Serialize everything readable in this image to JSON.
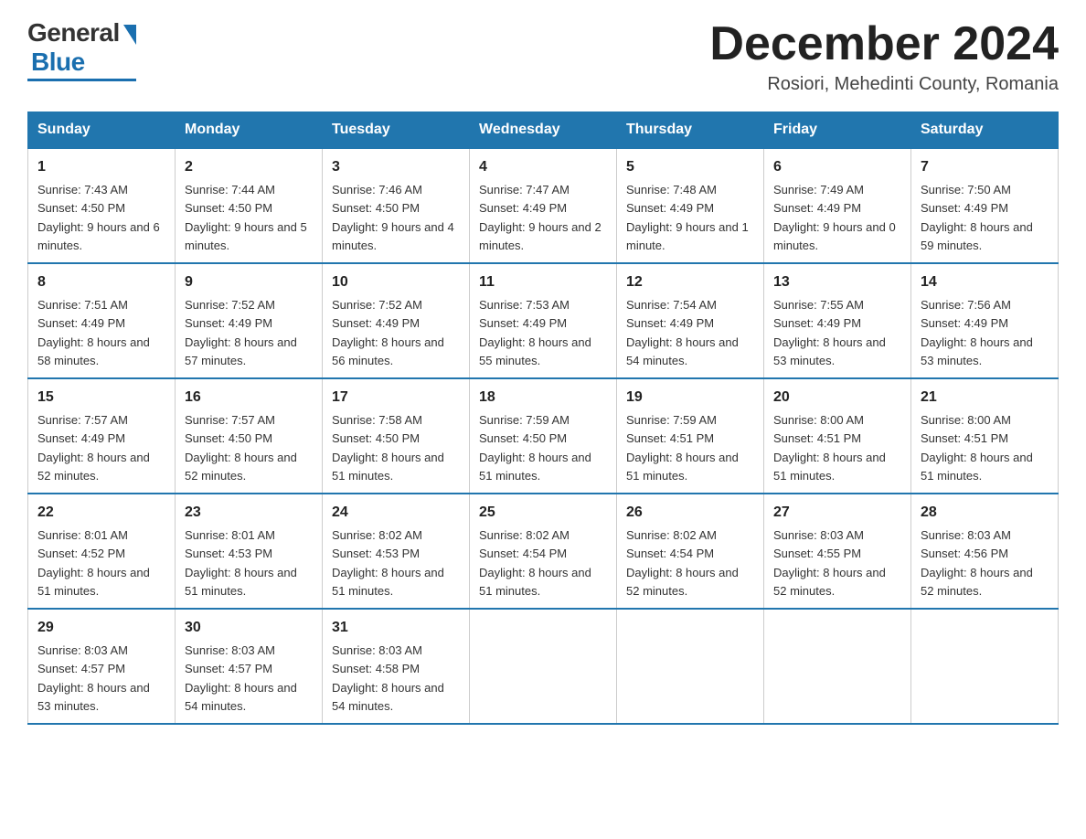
{
  "header": {
    "logo_general": "General",
    "logo_blue": "Blue",
    "month_title": "December 2024",
    "subtitle": "Rosiori, Mehedinti County, Romania"
  },
  "days_of_week": [
    "Sunday",
    "Monday",
    "Tuesday",
    "Wednesday",
    "Thursday",
    "Friday",
    "Saturday"
  ],
  "weeks": [
    [
      {
        "day": "1",
        "sunrise": "7:43 AM",
        "sunset": "4:50 PM",
        "daylight": "9 hours and 6 minutes."
      },
      {
        "day": "2",
        "sunrise": "7:44 AM",
        "sunset": "4:50 PM",
        "daylight": "9 hours and 5 minutes."
      },
      {
        "day": "3",
        "sunrise": "7:46 AM",
        "sunset": "4:50 PM",
        "daylight": "9 hours and 4 minutes."
      },
      {
        "day": "4",
        "sunrise": "7:47 AM",
        "sunset": "4:49 PM",
        "daylight": "9 hours and 2 minutes."
      },
      {
        "day": "5",
        "sunrise": "7:48 AM",
        "sunset": "4:49 PM",
        "daylight": "9 hours and 1 minute."
      },
      {
        "day": "6",
        "sunrise": "7:49 AM",
        "sunset": "4:49 PM",
        "daylight": "9 hours and 0 minutes."
      },
      {
        "day": "7",
        "sunrise": "7:50 AM",
        "sunset": "4:49 PM",
        "daylight": "8 hours and 59 minutes."
      }
    ],
    [
      {
        "day": "8",
        "sunrise": "7:51 AM",
        "sunset": "4:49 PM",
        "daylight": "8 hours and 58 minutes."
      },
      {
        "day": "9",
        "sunrise": "7:52 AM",
        "sunset": "4:49 PM",
        "daylight": "8 hours and 57 minutes."
      },
      {
        "day": "10",
        "sunrise": "7:52 AM",
        "sunset": "4:49 PM",
        "daylight": "8 hours and 56 minutes."
      },
      {
        "day": "11",
        "sunrise": "7:53 AM",
        "sunset": "4:49 PM",
        "daylight": "8 hours and 55 minutes."
      },
      {
        "day": "12",
        "sunrise": "7:54 AM",
        "sunset": "4:49 PM",
        "daylight": "8 hours and 54 minutes."
      },
      {
        "day": "13",
        "sunrise": "7:55 AM",
        "sunset": "4:49 PM",
        "daylight": "8 hours and 53 minutes."
      },
      {
        "day": "14",
        "sunrise": "7:56 AM",
        "sunset": "4:49 PM",
        "daylight": "8 hours and 53 minutes."
      }
    ],
    [
      {
        "day": "15",
        "sunrise": "7:57 AM",
        "sunset": "4:49 PM",
        "daylight": "8 hours and 52 minutes."
      },
      {
        "day": "16",
        "sunrise": "7:57 AM",
        "sunset": "4:50 PM",
        "daylight": "8 hours and 52 minutes."
      },
      {
        "day": "17",
        "sunrise": "7:58 AM",
        "sunset": "4:50 PM",
        "daylight": "8 hours and 51 minutes."
      },
      {
        "day": "18",
        "sunrise": "7:59 AM",
        "sunset": "4:50 PM",
        "daylight": "8 hours and 51 minutes."
      },
      {
        "day": "19",
        "sunrise": "7:59 AM",
        "sunset": "4:51 PM",
        "daylight": "8 hours and 51 minutes."
      },
      {
        "day": "20",
        "sunrise": "8:00 AM",
        "sunset": "4:51 PM",
        "daylight": "8 hours and 51 minutes."
      },
      {
        "day": "21",
        "sunrise": "8:00 AM",
        "sunset": "4:51 PM",
        "daylight": "8 hours and 51 minutes."
      }
    ],
    [
      {
        "day": "22",
        "sunrise": "8:01 AM",
        "sunset": "4:52 PM",
        "daylight": "8 hours and 51 minutes."
      },
      {
        "day": "23",
        "sunrise": "8:01 AM",
        "sunset": "4:53 PM",
        "daylight": "8 hours and 51 minutes."
      },
      {
        "day": "24",
        "sunrise": "8:02 AM",
        "sunset": "4:53 PM",
        "daylight": "8 hours and 51 minutes."
      },
      {
        "day": "25",
        "sunrise": "8:02 AM",
        "sunset": "4:54 PM",
        "daylight": "8 hours and 51 minutes."
      },
      {
        "day": "26",
        "sunrise": "8:02 AM",
        "sunset": "4:54 PM",
        "daylight": "8 hours and 52 minutes."
      },
      {
        "day": "27",
        "sunrise": "8:03 AM",
        "sunset": "4:55 PM",
        "daylight": "8 hours and 52 minutes."
      },
      {
        "day": "28",
        "sunrise": "8:03 AM",
        "sunset": "4:56 PM",
        "daylight": "8 hours and 52 minutes."
      }
    ],
    [
      {
        "day": "29",
        "sunrise": "8:03 AM",
        "sunset": "4:57 PM",
        "daylight": "8 hours and 53 minutes."
      },
      {
        "day": "30",
        "sunrise": "8:03 AM",
        "sunset": "4:57 PM",
        "daylight": "8 hours and 54 minutes."
      },
      {
        "day": "31",
        "sunrise": "8:03 AM",
        "sunset": "4:58 PM",
        "daylight": "8 hours and 54 minutes."
      },
      null,
      null,
      null,
      null
    ]
  ],
  "labels": {
    "sunrise": "Sunrise:",
    "sunset": "Sunset:",
    "daylight": "Daylight:"
  }
}
